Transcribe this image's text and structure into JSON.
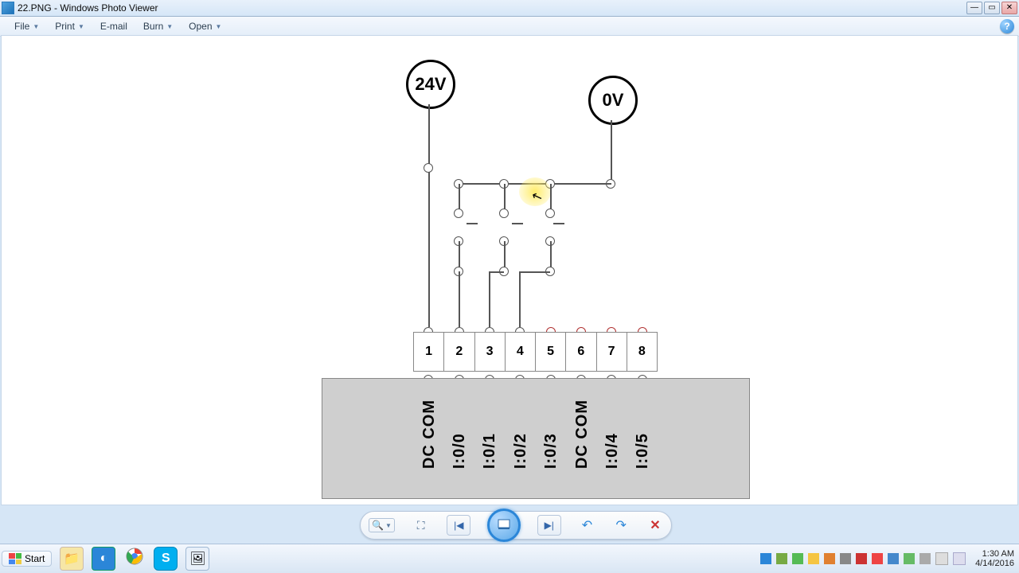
{
  "window": {
    "title": "22.PNG - Windows Photo Viewer"
  },
  "menus": {
    "file": "File",
    "print": "Print",
    "email": "E-mail",
    "burn": "Burn",
    "open": "Open"
  },
  "diagram": {
    "source_label": "24V",
    "ground_label": "0V",
    "terminals": [
      "1",
      "2",
      "3",
      "4",
      "5",
      "6",
      "7",
      "8"
    ],
    "plc_labels": [
      "DC COM",
      "I:0/0",
      "I:0/1",
      "I:0/2",
      "I:0/3",
      "DC COM",
      "I:0/4",
      "I:0/5"
    ]
  },
  "toolbar": {
    "zoom": "🔍",
    "fit": "⛶",
    "first": "|◀",
    "prev": "◀",
    "play": "▶",
    "next": "▶|",
    "rot_ccw": "↶",
    "rot_cw": "↷",
    "delete": "✕"
  },
  "taskbar": {
    "start": "Start",
    "time": "1:30 AM",
    "date": "4/14/2016"
  }
}
